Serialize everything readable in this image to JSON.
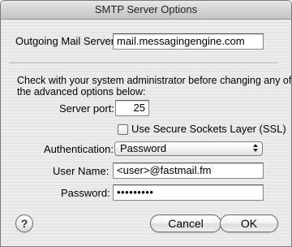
{
  "window": {
    "title": "SMTP Server Options"
  },
  "outgoing": {
    "label": "Outgoing Mail Server:",
    "value": "mail.messagingengine.com"
  },
  "advanced": {
    "note_line1": "Check with your system administrator before changing any of",
    "note_line2": "the advanced options below:",
    "port_label": "Server port:",
    "port_value": "25",
    "ssl_label": "Use Secure Sockets Layer (SSL)",
    "ssl_checked": false,
    "auth_label": "Authentication:",
    "auth_value": "Password",
    "username_label": "User Name:",
    "username_value": "<user>@fastmail.fm",
    "password_label": "Password:",
    "password_value": "•••••••••"
  },
  "buttons": {
    "help_glyph": "?",
    "cancel_label": "Cancel",
    "ok_label": "OK"
  },
  "icons": {
    "popup_arrows": "popup-arrows-icon",
    "help": "help-icon"
  }
}
